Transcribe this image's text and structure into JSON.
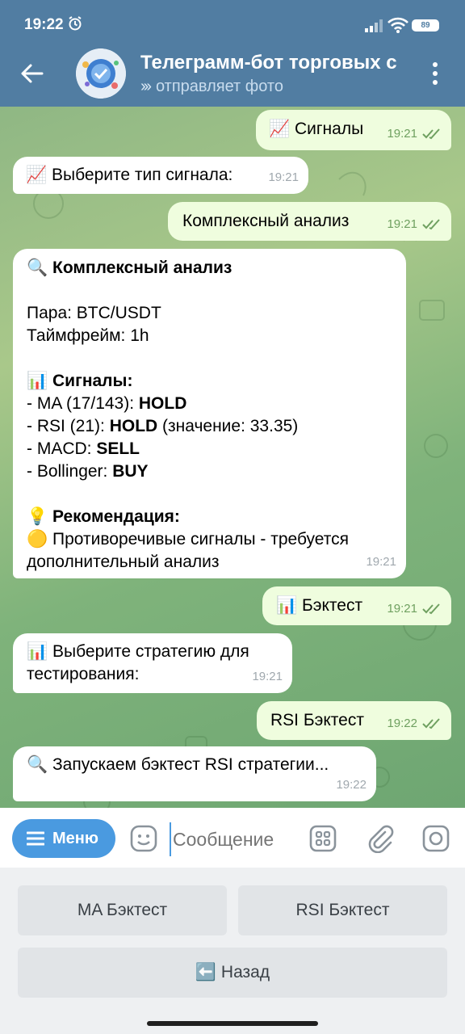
{
  "status_bar": {
    "time": "19:22",
    "battery": "89"
  },
  "header": {
    "title": "Телеграмм-бот торговых с",
    "subtitle": "отправляет фото"
  },
  "messages": [
    {
      "dir": "out",
      "emoji": "📈",
      "text": "Сигналы",
      "time": "19:21"
    },
    {
      "dir": "in",
      "emoji": "📈",
      "text": "Выберите тип сигнала:",
      "time": "19:21"
    },
    {
      "dir": "out",
      "text": "Комплексный анализ",
      "time": "19:21"
    },
    {
      "dir": "in",
      "time": "19:21",
      "analysis": {
        "emoji": "🔍",
        "heading": "Комплексный анализ",
        "pair_line": "Пара: BTC/USDT",
        "timeframe_line": "Таймфрейм: 1h",
        "signals_emoji": "📊",
        "signals_heading": "Сигналы:",
        "ma_prefix": "- MA (17/143): ",
        "ma_value": "HOLD",
        "rsi_prefix": "- RSI (21): ",
        "rsi_value": "HOLD",
        "rsi_suffix": " (значение: 33.35)",
        "macd_prefix": "- MACD: ",
        "macd_value": "SELL",
        "boll_prefix": "- Bollinger: ",
        "boll_value": "BUY",
        "rec_emoji": "💡",
        "rec_heading": "Рекомендация:",
        "rec_emoji2": "🟡",
        "rec_line1": "Противоречивые сигналы - требуется",
        "rec_line2": "дополнительный анализ"
      }
    },
    {
      "dir": "out",
      "emoji": "📊",
      "text": "Бэктест",
      "time": "19:21"
    },
    {
      "dir": "in",
      "emoji": "📊",
      "line1": "Выберите стратегию для",
      "line2": "тестирования:",
      "time": "19:21"
    },
    {
      "dir": "out",
      "text": "RSI Бэктест",
      "time": "19:22"
    },
    {
      "dir": "in",
      "emoji": "🔍",
      "text": "Запускаем бэктест RSI стратегии...",
      "time": "19:22"
    }
  ],
  "input": {
    "menu_label": "Меню",
    "placeholder": "Сообщение"
  },
  "keyboard": {
    "row1": [
      "MA Бэктест",
      "RSI Бэктест"
    ],
    "back_emoji": "⬅️",
    "back_label": "Назад"
  },
  "colors": {
    "header": "#517da2",
    "outgoing": "#effdde",
    "incoming": "#ffffff",
    "accent": "#4a9ae0"
  }
}
